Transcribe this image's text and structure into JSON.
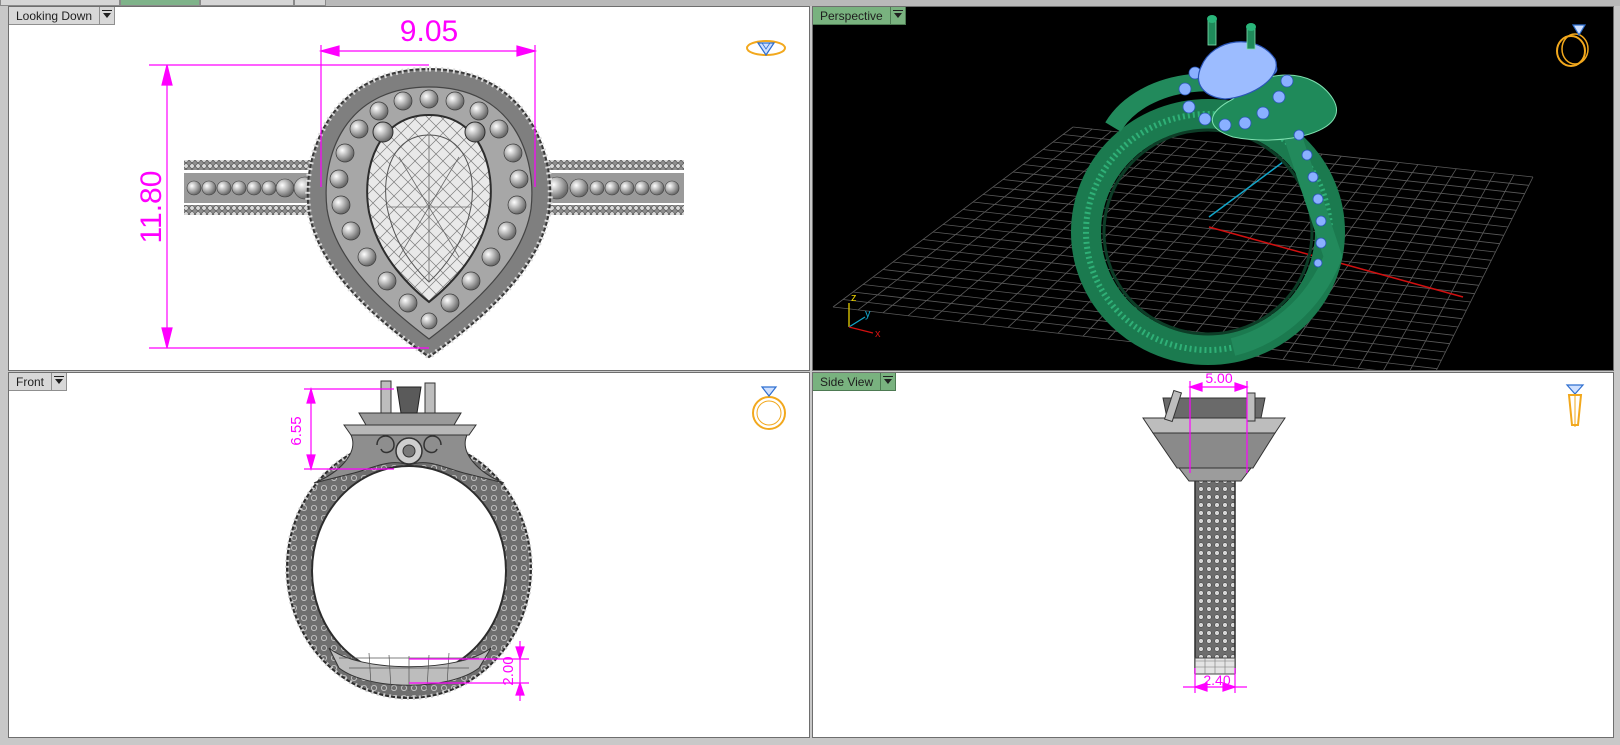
{
  "viewports": {
    "top": {
      "label": "Looking Down",
      "dim_width": "9.05",
      "dim_height": "11.80"
    },
    "perspective": {
      "label": "Perspective",
      "axis_z": "z",
      "axis_y": "y",
      "axis_x": "x"
    },
    "front": {
      "label": "Front",
      "dim_head": "6.55",
      "dim_shank": "2.00"
    },
    "side": {
      "label": "Side View",
      "dim_top": "5.00",
      "dim_bottom": "2.40"
    }
  },
  "colors": {
    "dimension": "#ff00ff",
    "ring_green": "#1f8a5a",
    "stone_blue": "#8ab0ff",
    "gizmo_gold": "#f2a81d",
    "grid": "#5a5a5a",
    "axis_x": "#d01010",
    "axis_y": "#12a5c9"
  },
  "icons": {
    "top": "ring-top-icon",
    "perspective": "ring-perspective-icon",
    "front": "ring-front-icon",
    "side": "ring-side-icon"
  }
}
